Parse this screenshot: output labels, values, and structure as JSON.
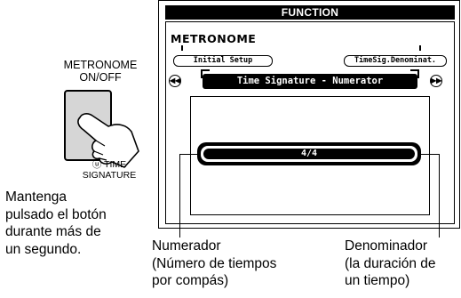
{
  "button": {
    "caption_line1": "METRONOME",
    "caption_line2": "ON/OFF",
    "sub_icon": "ⓤ",
    "sub_line1": "TIME",
    "sub_line2": "SIGNATURE",
    "color": "#d6d6d6"
  },
  "instruction": {
    "line1": "Mantenga",
    "line2": "pulsado el botón",
    "line3": "durante más de",
    "line4": "un segundo."
  },
  "lcd": {
    "header": "FUNCTION",
    "mode": "METRONOME",
    "left_slot": "Initial Setup",
    "right_slot": "TimeSig.Denominat.",
    "prev_icon": "rewind-icon",
    "next_icon": "fast-forward-icon",
    "prev_glyph": "◀◀",
    "next_glyph": "▶▶",
    "parameter": "Time Signature - Numerator",
    "value": "4/4"
  },
  "callouts": {
    "numerator_line1": "Numerador",
    "numerator_line2": "(Número de tiempos",
    "numerator_line3": "por compás)",
    "denominator_line1": "Denominador",
    "denominator_line2": "(la duración de",
    "denominator_line3": "un tiempo)"
  }
}
